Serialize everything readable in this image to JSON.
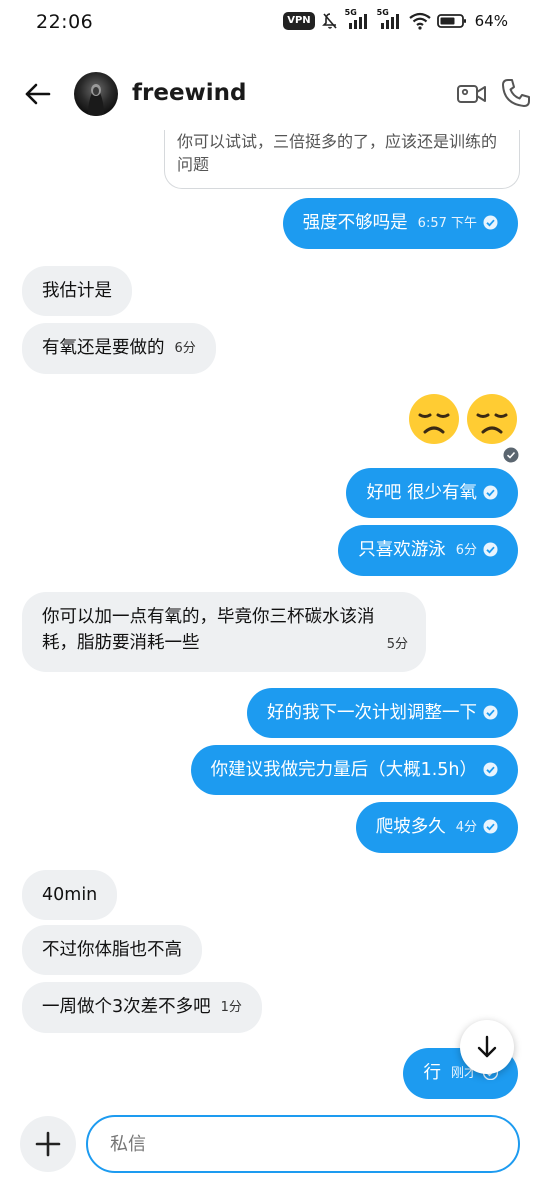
{
  "status_bar": {
    "time": "22:06",
    "vpn_label": "VPN",
    "network1": "5G",
    "network2": "5G",
    "battery_percent": "64%"
  },
  "header": {
    "contact_name": "freewind"
  },
  "quoted_message": "你可以试试，三倍挺多的了，应该还是训练的问题",
  "messages": [
    {
      "id": "m1",
      "side": "out",
      "text": "强度不够吗是",
      "time": "6:57 下午"
    },
    {
      "id": "m2",
      "side": "in",
      "text": "我估计是",
      "time": ""
    },
    {
      "id": "m3",
      "side": "in",
      "text": "有氧还是要做的",
      "time": "6分"
    },
    {
      "id": "m4",
      "side": "out",
      "emojis": [
        "disappointed-face",
        "disappointed-face"
      ]
    },
    {
      "id": "m5",
      "side": "out",
      "text": "好吧 很少有氧",
      "time": ""
    },
    {
      "id": "m6",
      "side": "out",
      "text": "只喜欢游泳",
      "time": "6分"
    },
    {
      "id": "m7",
      "side": "in",
      "text": "你可以加一点有氧的，毕竟你三杯碳水该消耗，脂肪要消耗一些",
      "time": "5分"
    },
    {
      "id": "m8",
      "side": "out",
      "text": "好的我下一次计划调整一下",
      "time": ""
    },
    {
      "id": "m9",
      "side": "out",
      "text": "你建议我做完力量后（大概1.5h）",
      "time": ""
    },
    {
      "id": "m10",
      "side": "out",
      "text": "爬坡多久",
      "time": "4分"
    },
    {
      "id": "m11",
      "side": "in",
      "text": "40min",
      "time": ""
    },
    {
      "id": "m12",
      "side": "in",
      "text": "不过你体脂也不高",
      "time": ""
    },
    {
      "id": "m13",
      "side": "in",
      "text": "一周做个3次差不多吧",
      "time": "1分"
    },
    {
      "id": "m14",
      "side": "out",
      "text": "行",
      "time": "刚才"
    }
  ],
  "composer": {
    "placeholder": "私信"
  },
  "colors": {
    "accent": "#1d9bf0",
    "incoming_bubble": "#eef0f2"
  }
}
